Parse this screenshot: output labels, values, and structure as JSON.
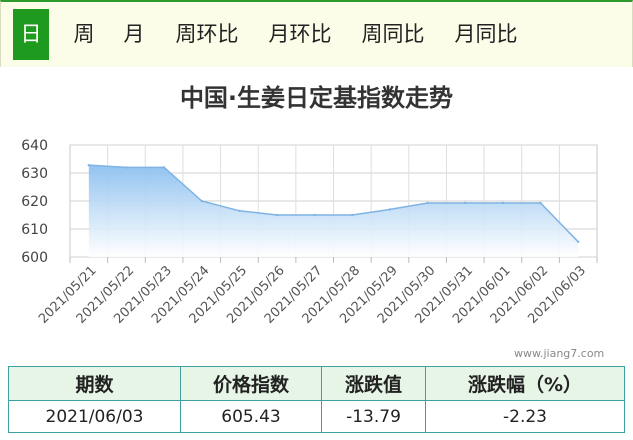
{
  "tabs": [
    {
      "label": "日",
      "active": true
    },
    {
      "label": "周",
      "active": false
    },
    {
      "label": "月",
      "active": false
    },
    {
      "label": "周环比",
      "active": false
    },
    {
      "label": "月环比",
      "active": false
    },
    {
      "label": "周同比",
      "active": false
    },
    {
      "label": "月同比",
      "active": false
    }
  ],
  "watermark": "www.jiang7.com",
  "colors": {
    "accent": "#1e9a1e",
    "line": "#7fb3e3",
    "fill_top": "#8cc0ef",
    "table_border": "#3ea1a1"
  },
  "chart_data": {
    "type": "area",
    "title": "中国·生姜日定基指数走势",
    "categories": [
      "2021/05/21",
      "2021/05/22",
      "2021/05/23",
      "2021/05/24",
      "2021/05/25",
      "2021/05/26",
      "2021/05/27",
      "2021/05/28",
      "2021/05/29",
      "2021/05/30",
      "2021/05/31",
      "2021/06/01",
      "2021/06/02",
      "2021/06/03"
    ],
    "series": [
      {
        "values": [
          632.8,
          632.0,
          632.0,
          620.0,
          616.5,
          615.0,
          615.0,
          615.0,
          617.0,
          619.3,
          619.3,
          619.3,
          619.3,
          605.43
        ]
      }
    ],
    "yticks": [
      600,
      610,
      620,
      630,
      640
    ],
    "ylim": [
      600,
      640
    ],
    "grid": true
  },
  "table": {
    "headers": [
      "期数",
      "价格指数",
      "涨跌值",
      "涨跌幅（%）"
    ],
    "rows": [
      [
        "2021/06/03",
        "605.43",
        "-13.79",
        "-2.23"
      ]
    ]
  }
}
